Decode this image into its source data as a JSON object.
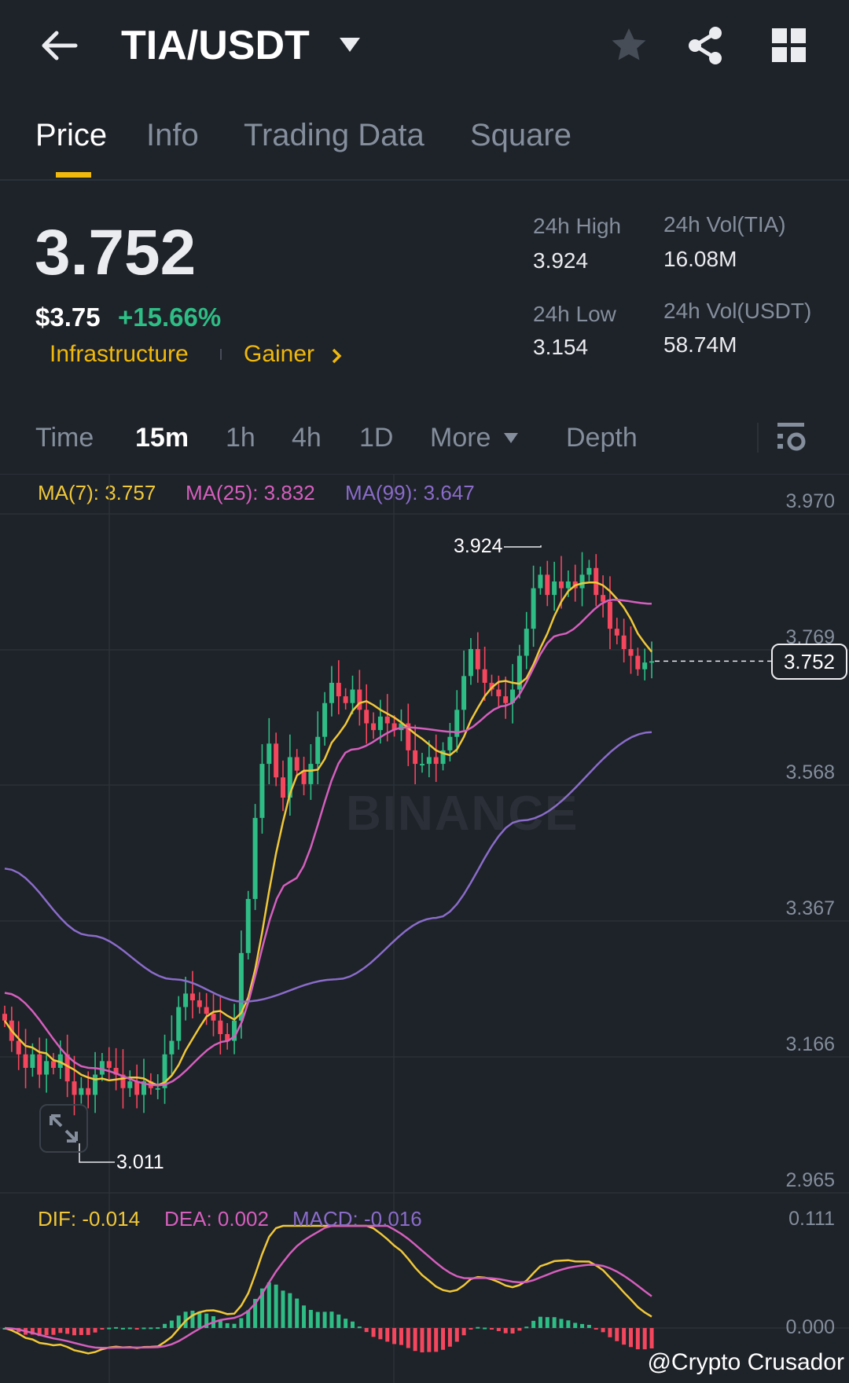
{
  "header": {
    "title": "TIA/USDT",
    "icons": [
      "back-arrow-icon",
      "dropdown-caret-icon",
      "star-icon",
      "share-icon",
      "grid-icon"
    ]
  },
  "tabs": [
    {
      "label": "Price"
    },
    {
      "label": "Info"
    },
    {
      "label": "Trading Data"
    },
    {
      "label": "Square"
    }
  ],
  "ticker": {
    "last": "3.752",
    "usd": "$3.75",
    "change": "+15.66%",
    "tags": [
      "Infrastructure",
      "Gainer"
    ]
  },
  "stats": {
    "high_label": "24h High",
    "high": "3.924",
    "low_label": "24h Low",
    "low": "3.154",
    "vol_base_label": "24h Vol(TIA)",
    "vol_base": "16.08M",
    "vol_quote_label": "24h Vol(USDT)",
    "vol_quote": "58.74M"
  },
  "timeframes": [
    "Time",
    "15m",
    "1h",
    "4h",
    "1D",
    "More",
    "Depth"
  ],
  "ma_legend": {
    "ma7": "MA(7): 3.757",
    "ma25": "MA(25): 3.832",
    "ma99": "MA(99): 3.647"
  },
  "macd_legend": {
    "dif": "DIF: -0.014",
    "dea": "DEA: 0.002",
    "macd": "MACD: -0.016"
  },
  "colors": {
    "bg": "#1e2229",
    "up": "#2ebd85",
    "down": "#f6465d",
    "accent": "#f0b90b",
    "ma7": "#f0c838",
    "ma25": "#d55fbd",
    "ma99": "#8a6cc9"
  },
  "watermark": "BINANCE",
  "credit": "@Crypto Crusador",
  "chart_data": {
    "type": "candlestick",
    "interval": "15m",
    "price_axis": [
      "3.970",
      "3.769",
      "3.568",
      "3.367",
      "3.166",
      "2.965"
    ],
    "ylim": [
      2.965,
      3.97
    ],
    "macd_axis": [
      "0.111",
      "0.000"
    ],
    "last_price": "3.752",
    "high_marker": "3.924",
    "low_marker": "3.011",
    "closes": [
      3.22,
      3.19,
      3.17,
      3.15,
      3.17,
      3.14,
      3.16,
      3.15,
      3.17,
      3.13,
      3.11,
      3.12,
      3.11,
      3.14,
      3.16,
      3.15,
      3.14,
      3.12,
      3.13,
      3.11,
      3.13,
      3.12,
      3.12,
      3.17,
      3.19,
      3.24,
      3.26,
      3.25,
      3.24,
      3.23,
      3.22,
      3.2,
      3.19,
      3.22,
      3.32,
      3.4,
      3.52,
      3.6,
      3.63,
      3.58,
      3.55,
      3.61,
      3.59,
      3.57,
      3.6,
      3.64,
      3.69,
      3.72,
      3.7,
      3.69,
      3.71,
      3.68,
      3.66,
      3.65,
      3.67,
      3.66,
      3.65,
      3.66,
      3.62,
      3.6,
      3.6,
      3.61,
      3.6,
      3.62,
      3.64,
      3.68,
      3.73,
      3.77,
      3.74,
      3.72,
      3.71,
      3.7,
      3.69,
      3.71,
      3.76,
      3.8,
      3.86,
      3.88,
      3.85,
      3.87,
      3.86,
      3.87,
      3.86,
      3.88,
      3.89,
      3.85,
      3.84,
      3.8,
      3.79,
      3.77,
      3.76,
      3.74,
      3.75,
      3.752
    ],
    "ma25": {
      "index": [
        0,
        11,
        20,
        29,
        37,
        45,
        52,
        59,
        65,
        72,
        79,
        84
      ],
      "values": [
        3.261,
        3.15,
        3.124,
        3.19,
        3.425,
        3.621,
        3.654,
        3.647,
        3.686,
        3.791,
        3.843,
        3.837
      ]
    },
    "ma99": {
      "index": [
        0,
        11,
        22,
        31,
        43,
        56,
        67,
        84
      ],
      "values": [
        3.445,
        3.346,
        3.281,
        3.248,
        3.281,
        3.372,
        3.516,
        3.647
      ]
    }
  }
}
